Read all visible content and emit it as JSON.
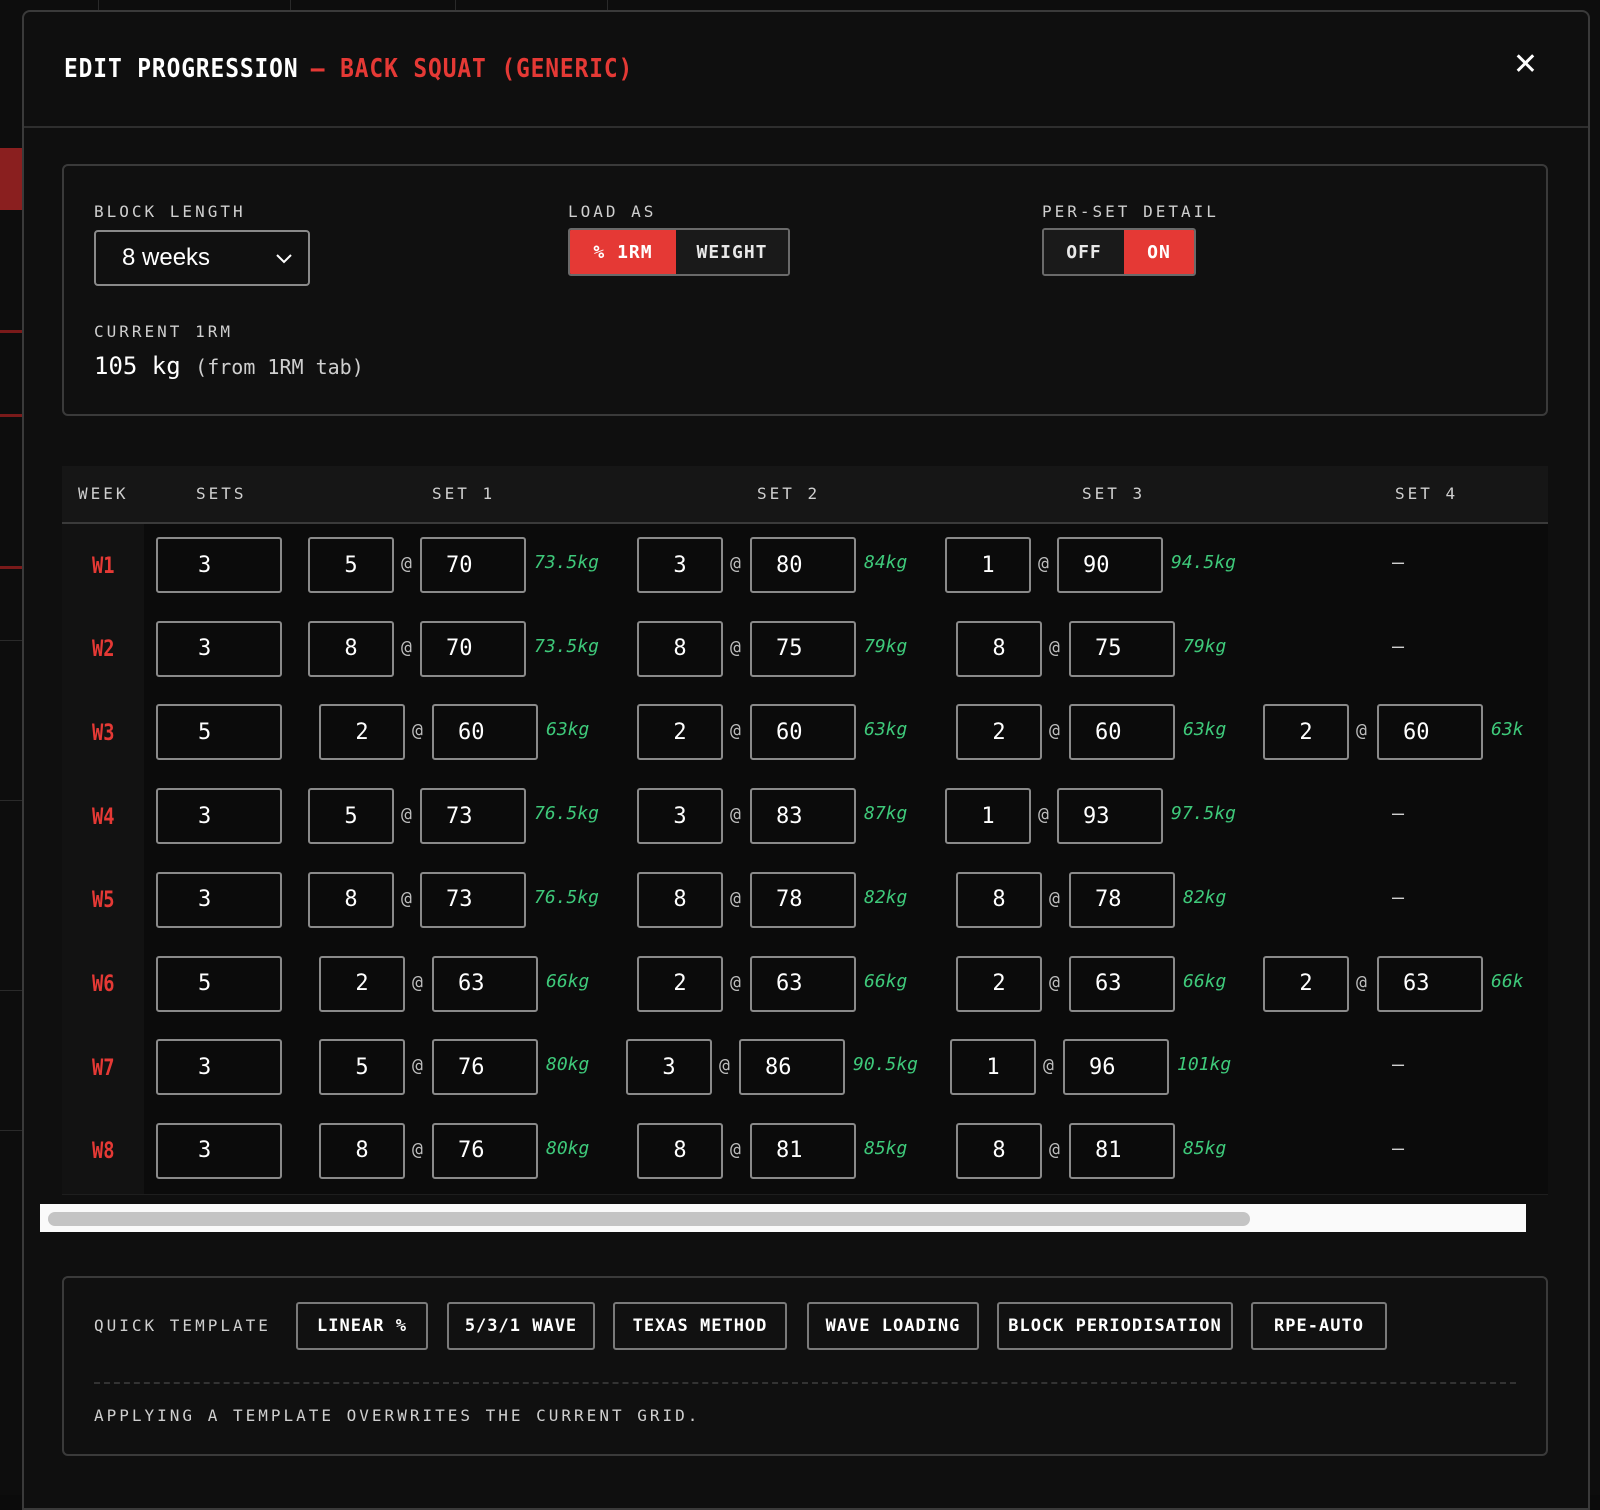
{
  "modal": {
    "title": "EDIT PROGRESSION",
    "subtitle": "— BACK SQUAT (GENERIC)",
    "close_icon": "close-icon"
  },
  "settings": {
    "block_length_label": "BLOCK LENGTH",
    "block_length_value": "8 weeks",
    "load_as_label": "LOAD AS",
    "load_as_options": [
      "% 1RM",
      "WEIGHT"
    ],
    "load_as_selected": "% 1RM",
    "per_set_label": "PER-SET DETAIL",
    "per_set_options": [
      "OFF",
      "ON"
    ],
    "per_set_selected": "ON",
    "current_1rm_label": "CURRENT 1RM",
    "current_1rm_value": "105 kg",
    "current_1rm_note": "(from 1RM tab)"
  },
  "grid": {
    "headers": {
      "week": "WEEK",
      "sets": "SETS",
      "set1": "SET 1",
      "set2": "SET 2",
      "set3": "SET 3",
      "set4": "SET 4"
    },
    "at_symbol": "@",
    "empty_symbol": "—",
    "rows": [
      {
        "week": "W1",
        "sets": "3",
        "set1": {
          "reps": "5",
          "pct": "70",
          "kg": "73.5kg"
        },
        "set2": {
          "reps": "3",
          "pct": "80",
          "kg": "84kg"
        },
        "set3": {
          "reps": "1",
          "pct": "90",
          "kg": "94.5kg"
        },
        "set4": null
      },
      {
        "week": "W2",
        "sets": "3",
        "set1": {
          "reps": "8",
          "pct": "70",
          "kg": "73.5kg"
        },
        "set2": {
          "reps": "8",
          "pct": "75",
          "kg": "79kg"
        },
        "set3": {
          "reps": "8",
          "pct": "75",
          "kg": "79kg"
        },
        "set4": null
      },
      {
        "week": "W3",
        "sets": "5",
        "set1": {
          "reps": "2",
          "pct": "60",
          "kg": "63kg"
        },
        "set2": {
          "reps": "2",
          "pct": "60",
          "kg": "63kg"
        },
        "set3": {
          "reps": "2",
          "pct": "60",
          "kg": "63kg"
        },
        "set4": {
          "reps": "2",
          "pct": "60",
          "kg": "63k"
        }
      },
      {
        "week": "W4",
        "sets": "3",
        "set1": {
          "reps": "5",
          "pct": "73",
          "kg": "76.5kg"
        },
        "set2": {
          "reps": "3",
          "pct": "83",
          "kg": "87kg"
        },
        "set3": {
          "reps": "1",
          "pct": "93",
          "kg": "97.5kg"
        },
        "set4": null
      },
      {
        "week": "W5",
        "sets": "3",
        "set1": {
          "reps": "8",
          "pct": "73",
          "kg": "76.5kg"
        },
        "set2": {
          "reps": "8",
          "pct": "78",
          "kg": "82kg"
        },
        "set3": {
          "reps": "8",
          "pct": "78",
          "kg": "82kg"
        },
        "set4": null
      },
      {
        "week": "W6",
        "sets": "5",
        "set1": {
          "reps": "2",
          "pct": "63",
          "kg": "66kg"
        },
        "set2": {
          "reps": "2",
          "pct": "63",
          "kg": "66kg"
        },
        "set3": {
          "reps": "2",
          "pct": "63",
          "kg": "66kg"
        },
        "set4": {
          "reps": "2",
          "pct": "63",
          "kg": "66k"
        }
      },
      {
        "week": "W7",
        "sets": "3",
        "set1": {
          "reps": "5",
          "pct": "76",
          "kg": "80kg"
        },
        "set2": {
          "reps": "3",
          "pct": "86",
          "kg": "90.5kg"
        },
        "set3": {
          "reps": "1",
          "pct": "96",
          "kg": "101kg"
        },
        "set4": null
      },
      {
        "week": "W8",
        "sets": "3",
        "set1": {
          "reps": "8",
          "pct": "76",
          "kg": "80kg"
        },
        "set2": {
          "reps": "8",
          "pct": "81",
          "kg": "85kg"
        },
        "set3": {
          "reps": "8",
          "pct": "81",
          "kg": "85kg"
        },
        "set4": null
      }
    ]
  },
  "templates": {
    "label": "QUICK TEMPLATE",
    "buttons": [
      "LINEAR %",
      "5/3/1 WAVE",
      "TEXAS METHOD",
      "WAVE LOADING",
      "BLOCK PERIODISATION",
      "RPE-AUTO"
    ],
    "note": "APPLYING A TEMPLATE OVERWRITES THE CURRENT GRID."
  },
  "colors": {
    "accent": "#e53935",
    "kg_text": "#3ec97a",
    "background": "#0f0f0f"
  }
}
